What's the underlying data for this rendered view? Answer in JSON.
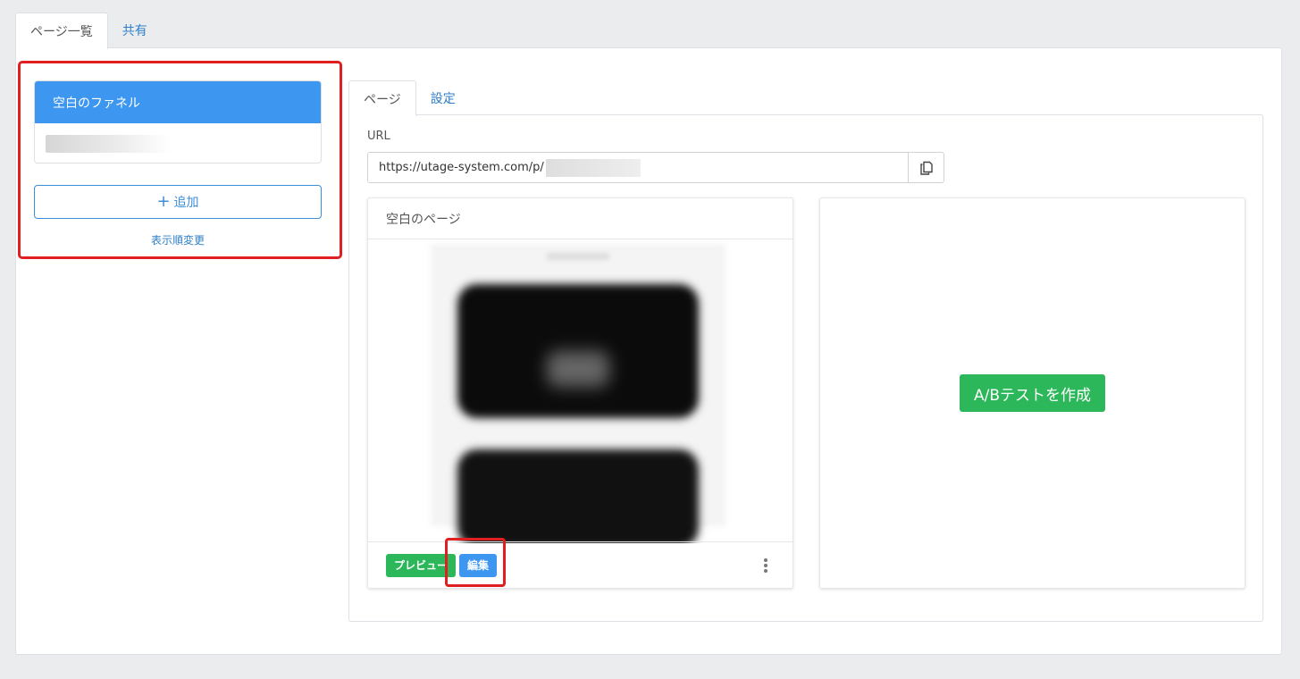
{
  "top_tabs": [
    {
      "label": "ページ一覧",
      "active": true
    },
    {
      "label": "共有",
      "active": false
    }
  ],
  "funnel": {
    "name": "空白のファネル",
    "add_button": {
      "icon": "plus-icon",
      "label": "追加"
    },
    "reorder_link": "表示順変更"
  },
  "inner_tabs": [
    {
      "label": "ページ",
      "active": true
    },
    {
      "label": "設定",
      "active": false
    }
  ],
  "url": {
    "label": "URL",
    "value": "https://utage-system.com/p/",
    "copy_icon": "copy-icon"
  },
  "page_card": {
    "title": "空白のページ",
    "preview_button": "プレビュー",
    "edit_button": "編集",
    "more_icon": "kebab-menu-icon"
  },
  "ab_test": {
    "button": "A/Bテストを作成"
  },
  "colors": {
    "primary": "#3d97f0",
    "success": "#2cb85a",
    "link": "#2f80c8",
    "highlight": "#e02020",
    "background": "#ebecee"
  }
}
